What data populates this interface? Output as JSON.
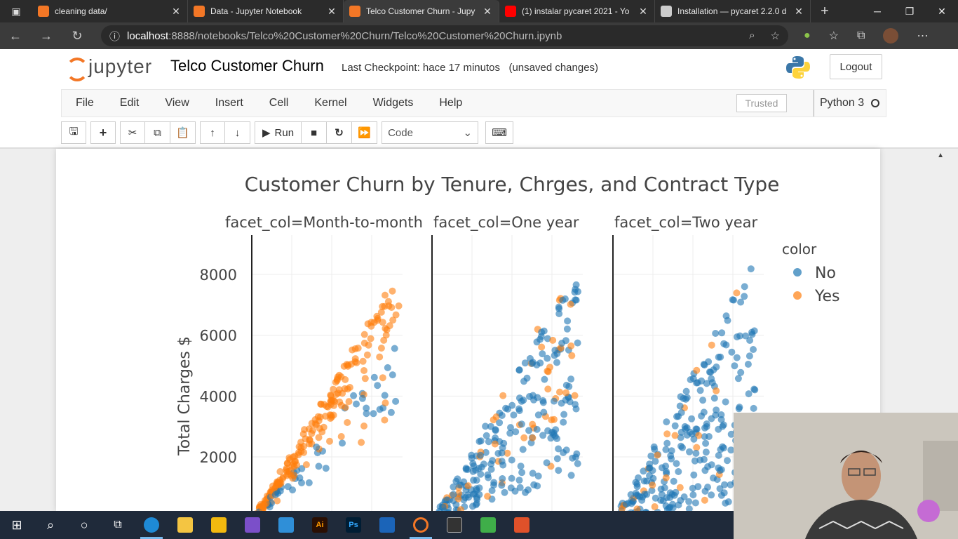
{
  "browser": {
    "tabs": [
      {
        "title": "cleaning data/",
        "favicon_color": "#f37726",
        "active": false
      },
      {
        "title": "Data - Jupyter Notebook",
        "favicon_color": "#f37726",
        "active": false
      },
      {
        "title": "Telco Customer Churn - Jupy",
        "favicon_color": "#f37726",
        "active": true
      },
      {
        "title": "(1) instalar pycaret 2021 - Yo",
        "favicon_color": "#ff0000",
        "active": false
      },
      {
        "title": "Installation — pycaret 2.2.0 d",
        "favicon_color": "#cccccc",
        "active": false
      }
    ],
    "url_host": "localhost",
    "url_path": ":8888/notebooks/Telco%20Customer%20Churn/Telco%20Customer%20Churn.ipynb"
  },
  "jupyter": {
    "logo_text": "jupyter",
    "notebook_title": "Telco Customer Churn",
    "checkpoint": "Last Checkpoint: hace 17 minutos   (unsaved changes)",
    "logout_label": "Logout",
    "menu": [
      "File",
      "Edit",
      "View",
      "Insert",
      "Cell",
      "Kernel",
      "Widgets",
      "Help"
    ],
    "trusted_label": "Trusted",
    "kernel_label": "Python 3",
    "run_label": "Run",
    "cell_type": "Code"
  },
  "chart_data": {
    "type": "scatter",
    "title": "Customer Churn by Tenure, Chrges, and Contract Type",
    "ylabel": "Total Charges $",
    "yticks": [
      2000,
      4000,
      6000,
      8000
    ],
    "ylim": [
      0,
      9000
    ],
    "legend_title": "color",
    "legend_position": "top-right",
    "grid": true,
    "series": [
      {
        "name": "No",
        "color": "#1f77b4"
      },
      {
        "name": "Yes",
        "color": "#ff7f0e"
      }
    ],
    "facets": [
      {
        "label": "facet_col=Month-to-month",
        "max_total_charges": 8100
      },
      {
        "label": "facet_col=One year",
        "max_total_charges": 8700
      },
      {
        "label": "facet_col=Two year",
        "max_total_charges": 8700
      }
    ]
  }
}
